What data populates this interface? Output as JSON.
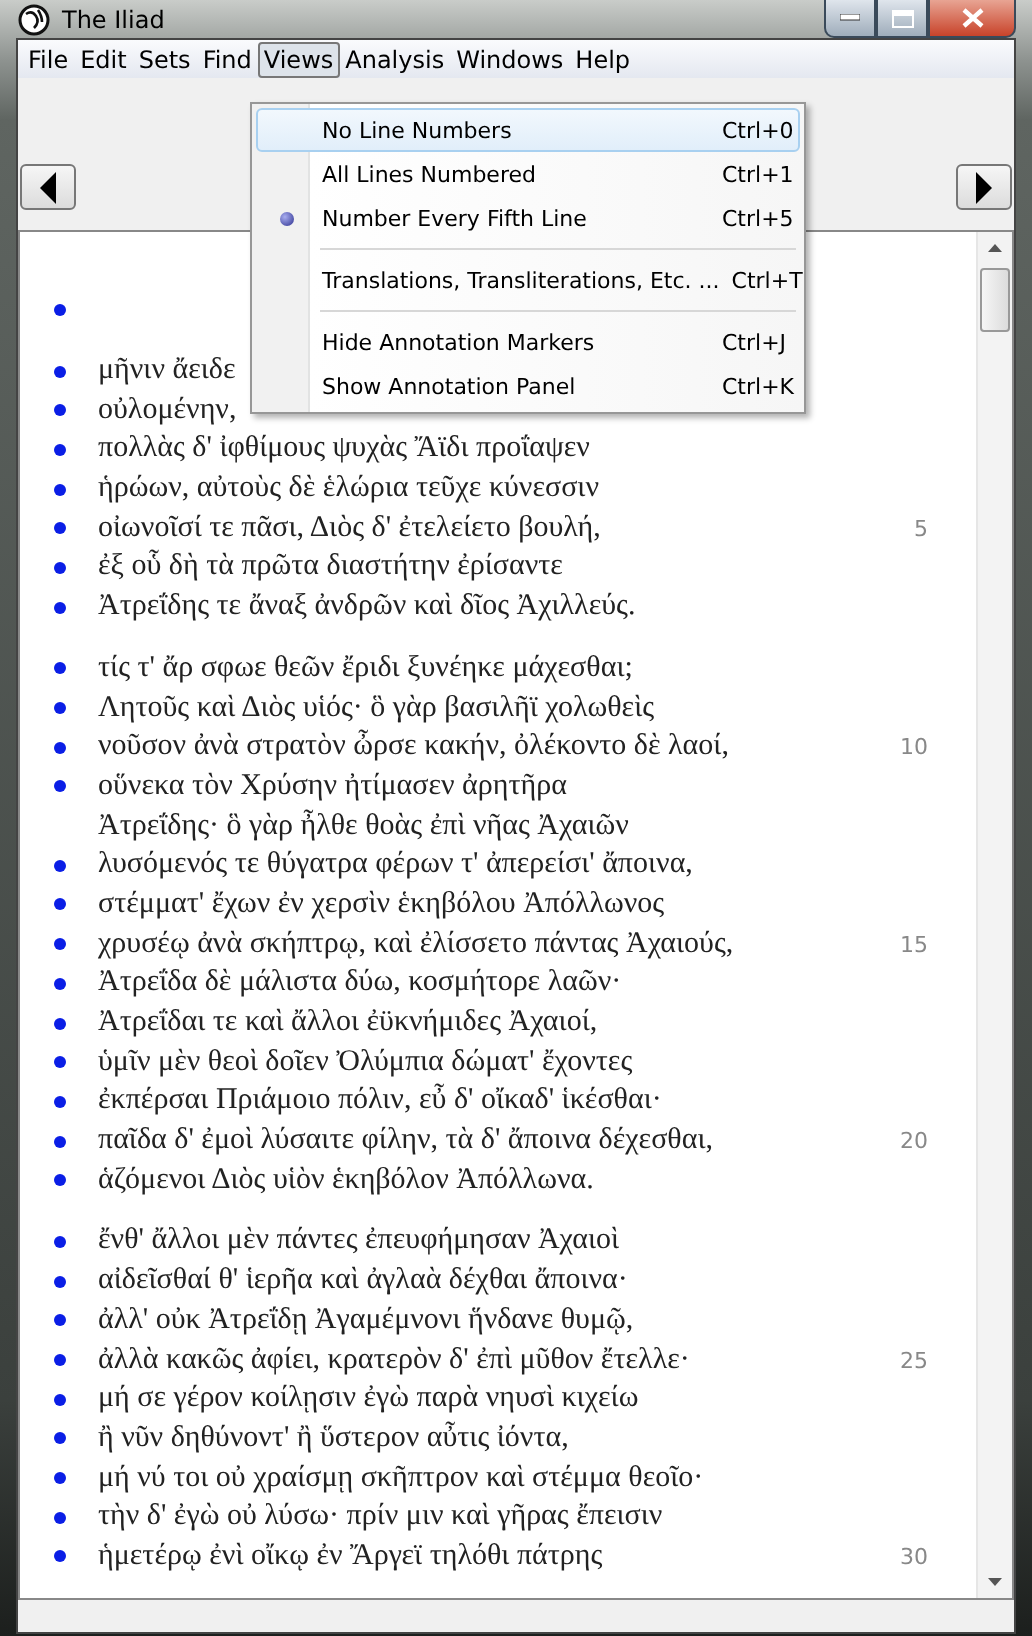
{
  "window": {
    "title": "The Iliad"
  },
  "menu_bar": [
    {
      "label": "File",
      "selected": false
    },
    {
      "label": "Edit",
      "selected": false
    },
    {
      "label": "Sets",
      "selected": false
    },
    {
      "label": "Find",
      "selected": false
    },
    {
      "label": "Views",
      "selected": true
    },
    {
      "label": "Analysis",
      "selected": false
    },
    {
      "label": "Windows",
      "selected": false
    },
    {
      "label": "Help",
      "selected": false
    }
  ],
  "views_menu": [
    {
      "kind": "item",
      "label": "No Line Numbers",
      "shortcut": "Ctrl+0",
      "selected": false,
      "highlighted": true
    },
    {
      "kind": "item",
      "label": "All Lines Numbered",
      "shortcut": "Ctrl+1",
      "selected": false,
      "highlighted": false
    },
    {
      "kind": "item",
      "label": "Number Every Fifth Line",
      "shortcut": "Ctrl+5",
      "selected": true,
      "highlighted": false
    },
    {
      "kind": "separator"
    },
    {
      "kind": "item",
      "label": "Translations, Transliterations, Etc. ...",
      "shortcut": "Ctrl+T",
      "selected": false,
      "highlighted": false
    },
    {
      "kind": "separator"
    },
    {
      "kind": "item",
      "label": "Hide Annotation Markers",
      "shortcut": "Ctrl+J",
      "selected": false,
      "highlighted": false
    },
    {
      "kind": "item",
      "label": "Show Annotation Panel",
      "shortcut": "Ctrl+K",
      "selected": false,
      "highlighted": false
    }
  ],
  "stanzas": [
    {
      "lines": [
        {
          "marker": true
        }
      ]
    },
    {
      "lines": [
        {
          "text": "μῆνιν ἄειδε",
          "marker": true
        },
        {
          "text": "οὐλομένην,",
          "marker": true
        },
        {
          "text": "πολλὰς δ' ἰφθίμους ψυχὰς Ἄϊδι προΐαψεν",
          "marker": true
        },
        {
          "text": "ἡρώων, αὐτοὺς δὲ ἑλώρια τεῦχε κύνεσσιν",
          "marker": true
        },
        {
          "text": "οἰωνοῖσί τε πᾶσι, Διὸς δ' ἐτελείετο βουλή,",
          "marker": true,
          "number": "5"
        },
        {
          "text": "ἐξ οὗ δὴ τὰ πρῶτα διαστήτην ἐρίσαντε",
          "marker": true
        },
        {
          "text": "Ἀτρεΐδης τε ἄναξ ἀνδρῶν καὶ δῖος Ἀχιλλεύς.",
          "marker": true
        }
      ]
    },
    {
      "lines": [
        {
          "text": "τίς τ' ἄρ σφωε θεῶν ἔριδι ξυνέηκε μάχεσθαι;",
          "marker": true
        },
        {
          "text": "Λητοῦς καὶ Διὸς υἱός· ὃ γὰρ βασιλῆϊ χολωθεὶς",
          "marker": true
        },
        {
          "text": "νοῦσον ἀνὰ στρατὸν ὦρσε κακήν, ὀλέκοντο δὲ λαοί,",
          "marker": true,
          "number": "10"
        },
        {
          "text": "οὕνεκα τὸν Χρύσην ἠτίμασεν ἀρητῆρα",
          "marker": true
        },
        {
          "text": "Ἀτρεΐδης· ὃ γὰρ ἦλθε θοὰς ἐπὶ νῆας Ἀχαιῶν",
          "marker": false
        },
        {
          "text": "λυσόμενός τε θύγατρα φέρων τ' ἀπερείσι' ἄποινα,",
          "marker": true
        },
        {
          "text": "στέμματ' ἔχων ἐν χερσὶν ἑκηβόλου Ἀπόλλωνος",
          "marker": true
        },
        {
          "text": "χρυσέῳ ἀνὰ σκήπτρῳ, καὶ ἐλίσσετο πάντας Ἀχαιούς,",
          "marker": true,
          "number": "15"
        },
        {
          "text": "Ἀτρεΐδα δὲ μάλιστα δύω, κοσμήτορε λαῶν·",
          "marker": true
        },
        {
          "text": "Ἀτρεΐδαι τε καὶ ἄλλοι ἐϋκνήμιδες Ἀχαιοί,",
          "marker": true
        },
        {
          "text": "ὑμῖν μὲν θεοὶ δοῖεν Ὀλύμπια δώματ' ἔχοντες",
          "marker": true
        },
        {
          "text": "ἐκπέρσαι Πριάμοιο πόλιν, εὖ δ' οἴκαδ' ἱκέσθαι·",
          "marker": true
        },
        {
          "text": "παῖδα δ' ἐμοὶ λύσαιτε φίλην, τὰ δ' ἄποινα δέχεσθαι,",
          "marker": true,
          "number": "20"
        },
        {
          "text": "ἁζόμενοι Διὸς υἱὸν ἑκηβόλον Ἀπόλλωνα.",
          "marker": true
        }
      ]
    },
    {
      "lines": [
        {
          "text": "ἔνθ' ἄλλοι μὲν πάντες ἐπευφήμησαν Ἀχαιοὶ",
          "marker": true
        },
        {
          "text": "αἰδεῖσθαί θ' ἱερῆα καὶ ἀγλαὰ δέχθαι ἄποινα·",
          "marker": true
        },
        {
          "text": "ἀλλ' οὐκ Ἀτρεΐδῃ Ἀγαμέμνονι ἥνδανε θυμῷ,",
          "marker": true
        },
        {
          "text": "ἀλλὰ κακῶς ἀφίει, κρατερὸν δ' ἐπὶ μῦθον ἔτελλε·",
          "marker": true,
          "number": "25"
        },
        {
          "text": "μή σε γέρον κοίλῃσιν ἐγὼ παρὰ νηυσὶ κιχείω",
          "marker": true
        },
        {
          "text": "ἢ νῦν δηθύνοντ' ἢ ὕστερον αὖτις ἰόντα,",
          "marker": true
        },
        {
          "text": "μή νύ τοι οὐ χραίσμῃ σκῆπτρον καὶ στέμμα θεοῖο·",
          "marker": true
        },
        {
          "text": "τὴν δ' ἐγὼ οὐ λύσω· πρίν μιν καὶ γῆρας ἔπεισιν",
          "marker": true
        },
        {
          "text": "ἡμετέρῳ ἐνὶ οἴκῳ ἐν Ἄργεϊ τηλόθι πάτρης",
          "marker": true,
          "number": "30"
        }
      ]
    }
  ]
}
